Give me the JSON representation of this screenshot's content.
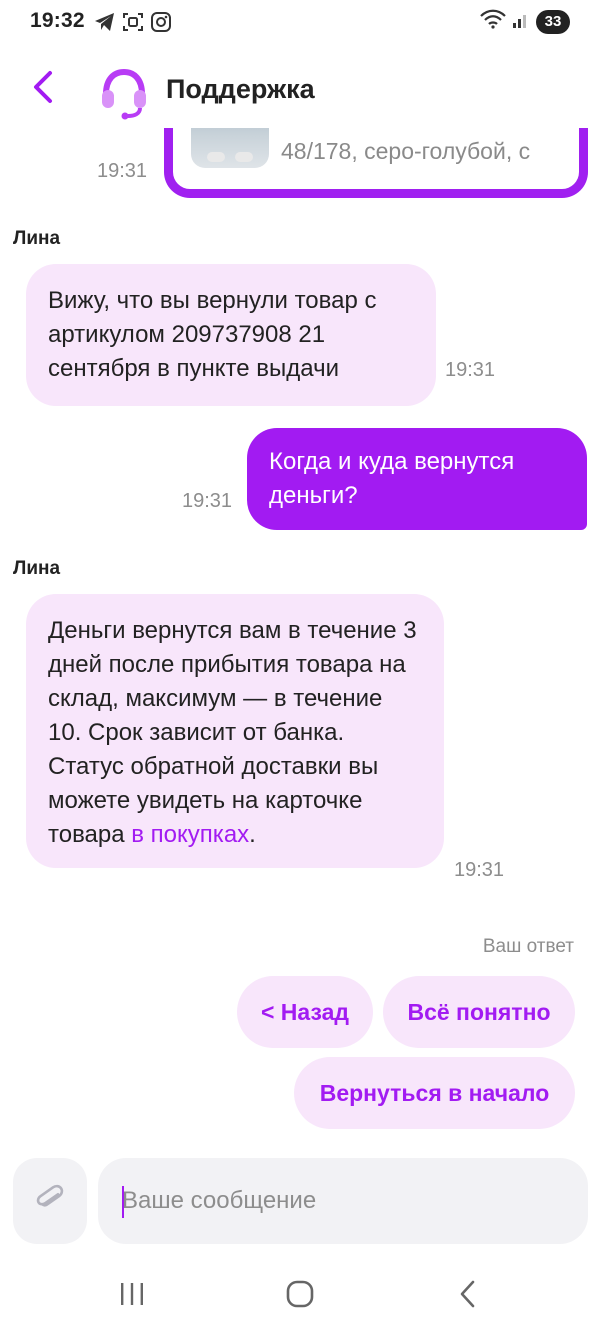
{
  "status_bar": {
    "time": "19:32",
    "battery": "33"
  },
  "header": {
    "title": "Поддержка"
  },
  "product": {
    "description": "48/178, серо-голубой, с",
    "time": "19:31"
  },
  "messages": [
    {
      "sender": "Лина",
      "text": "Вижу, что вы вернули товар с артикулом 209737908 21 сентября в пункте выдачи",
      "time": "19:31"
    },
    {
      "text": "Когда и куда вернутся деньги?",
      "time": "19:31"
    },
    {
      "sender": "Лина",
      "text": "Деньги вернутся вам в течение 3 дней после прибытия товара на склад, максимум — в течение 10. Срок зависит от банка. Статус обратной доставки вы можете увидеть на карточке товара ",
      "link": "в покупках",
      "suffix": ".",
      "time": "19:31"
    }
  ],
  "quick_replies": {
    "label": "Ваш ответ",
    "back": "< Назад",
    "understood": "Всё понятно",
    "restart": "Вернуться в начало"
  },
  "composer": {
    "placeholder": "Ваше сообщение"
  },
  "colors": {
    "accent": "#a21bf2",
    "bubble_incoming": "#f8e6fb",
    "input_bg": "#f2f2f5"
  }
}
